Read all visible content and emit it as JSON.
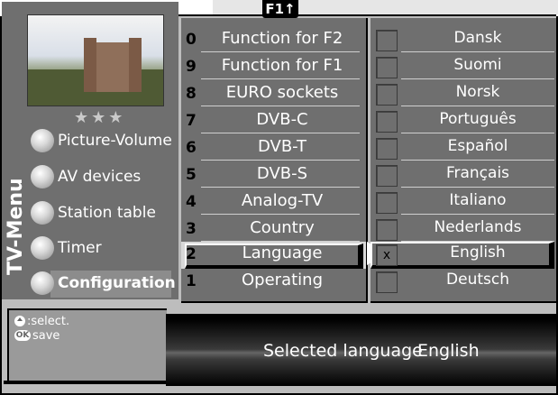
{
  "header": {
    "badge": "F1",
    "badge_icon": "arrow-up-icon"
  },
  "left_menu": {
    "vertical_title": "TV-Menu",
    "rating": "★★★",
    "items": [
      {
        "label": "Picture-Volume"
      },
      {
        "label": "AV devices"
      },
      {
        "label": "Station table"
      },
      {
        "label": "Timer"
      },
      {
        "label": "Configuration",
        "active": true
      }
    ]
  },
  "config_menu": {
    "items": [
      {
        "num": "0",
        "label": "Function for F2"
      },
      {
        "num": "9",
        "label": "Function for F1"
      },
      {
        "num": "8",
        "label": "EURO sockets"
      },
      {
        "num": "7",
        "label": "DVB-C"
      },
      {
        "num": "6",
        "label": "DVB-T"
      },
      {
        "num": "5",
        "label": "DVB-S"
      },
      {
        "num": "4",
        "label": "Analog-TV"
      },
      {
        "num": "3",
        "label": "Country"
      },
      {
        "num": "2",
        "label": "Language",
        "selected": true
      },
      {
        "num": "1",
        "label": "Operating"
      }
    ]
  },
  "languages": {
    "items": [
      {
        "label": "Dansk",
        "checked": ""
      },
      {
        "label": "Suomi",
        "checked": ""
      },
      {
        "label": "Norsk",
        "checked": ""
      },
      {
        "label": "Português",
        "checked": ""
      },
      {
        "label": "Español",
        "checked": ""
      },
      {
        "label": "Français",
        "checked": ""
      },
      {
        "label": "Italiano",
        "checked": ""
      },
      {
        "label": "Nederlands",
        "checked": ""
      },
      {
        "label": "English",
        "checked": "x",
        "selected": true
      },
      {
        "label": "Deutsch",
        "checked": ""
      }
    ]
  },
  "help": {
    "select_text": ":select.",
    "save_icon": "OK",
    "save_text": "save"
  },
  "status": {
    "label": "Selected language",
    "value": "English"
  }
}
